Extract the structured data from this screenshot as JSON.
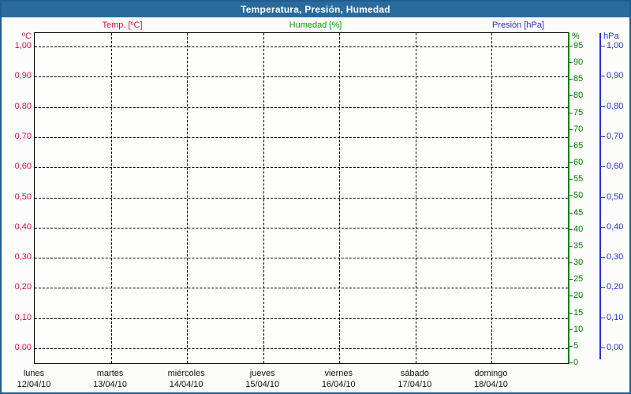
{
  "window": {
    "title": "Temperatura, Presión, Humedad"
  },
  "legend": {
    "temp": "Temp. [ºC]",
    "humidity": "Humedad [%]",
    "pressure": "Presión [hPa]"
  },
  "colors": {
    "titlebar_bg": "#2a6b9e",
    "titlebar_text": "#ffffff",
    "frame_border": "#1f5c8f",
    "background": "#fcfdfa",
    "grid": "#000000",
    "temp": "#c81446",
    "humidity": "#008000",
    "pressure": "#2233cc"
  },
  "chart_data": {
    "type": "line",
    "title": "Temperatura, Presión, Humedad",
    "grid": "dashed",
    "legend_position": "top",
    "note": "empty weekly plot — no data points drawn",
    "series": [
      {
        "name": "Temp. [ºC]",
        "unit": "ºC",
        "axis": "left",
        "color": "#c81446",
        "values": []
      },
      {
        "name": "Humedad [%]",
        "unit": "%",
        "axis": "right-inner",
        "color": "#008000",
        "values": []
      },
      {
        "name": "Presión [hPa]",
        "unit": "hPa",
        "axis": "right-outer",
        "color": "#2233cc",
        "values": []
      }
    ],
    "y_axes": {
      "temp": {
        "unit": "ºC",
        "range": [
          0.0,
          1.0
        ],
        "tick_step": 0.1,
        "ticks": [
          "1,00",
          "0,90",
          "0,80",
          "0,70",
          "0,60",
          "0,50",
          "0,40",
          "0,30",
          "0,20",
          "0,10",
          "0,00"
        ]
      },
      "humidity": {
        "unit": "%",
        "range": [
          0,
          100
        ],
        "tick_step": 5,
        "ticks": [
          "95",
          "90",
          "85",
          "80",
          "75",
          "70",
          "65",
          "60",
          "55",
          "50",
          "45",
          "40",
          "35",
          "30",
          "25",
          "20",
          "15",
          "10",
          "5",
          "0"
        ]
      },
      "pressure": {
        "unit": "hPa",
        "range": [
          0.0,
          1.0
        ],
        "tick_step": 0.1,
        "ticks": [
          "1,00",
          "0,90",
          "0,80",
          "0,70",
          "0,60",
          "0,50",
          "0,40",
          "0,30",
          "0,20",
          "0,10",
          "0,00"
        ]
      }
    },
    "x_axis": {
      "days": [
        {
          "name": "lunes",
          "date": "12/04/10"
        },
        {
          "name": "martes",
          "date": "13/04/10"
        },
        {
          "name": "miércoles",
          "date": "14/04/10"
        },
        {
          "name": "jueves",
          "date": "15/04/10"
        },
        {
          "name": "viernes",
          "date": "16/04/10"
        },
        {
          "name": "sábado",
          "date": "17/04/10"
        },
        {
          "name": "domingo",
          "date": "18/04/10"
        }
      ]
    }
  }
}
